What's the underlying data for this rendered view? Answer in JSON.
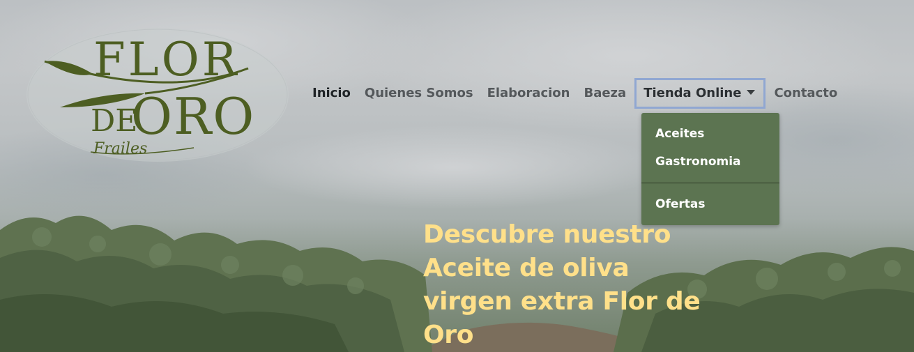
{
  "logo": {
    "line1": "FLOR",
    "line2": "DE ORO",
    "script": "Frailes",
    "color": "#4d5e22"
  },
  "nav": {
    "items": [
      {
        "label": "Inicio",
        "active": true
      },
      {
        "label": "Quienes Somos"
      },
      {
        "label": "Elaboracion"
      },
      {
        "label": "Baeza"
      },
      {
        "label": "Tienda Online",
        "dropdown": true,
        "icon": "caret-down-icon"
      },
      {
        "label": "Contacto"
      }
    ]
  },
  "dropdown": {
    "items": [
      {
        "label": "Aceites"
      },
      {
        "label": "Gastronomia"
      },
      {
        "label": "Ofertas"
      }
    ],
    "background": "#5c7451"
  },
  "hero": {
    "headline": "Descubre nuestro Aceite de oliva virgen extra Flor de Oro",
    "headline_color": "#ffe08a"
  }
}
